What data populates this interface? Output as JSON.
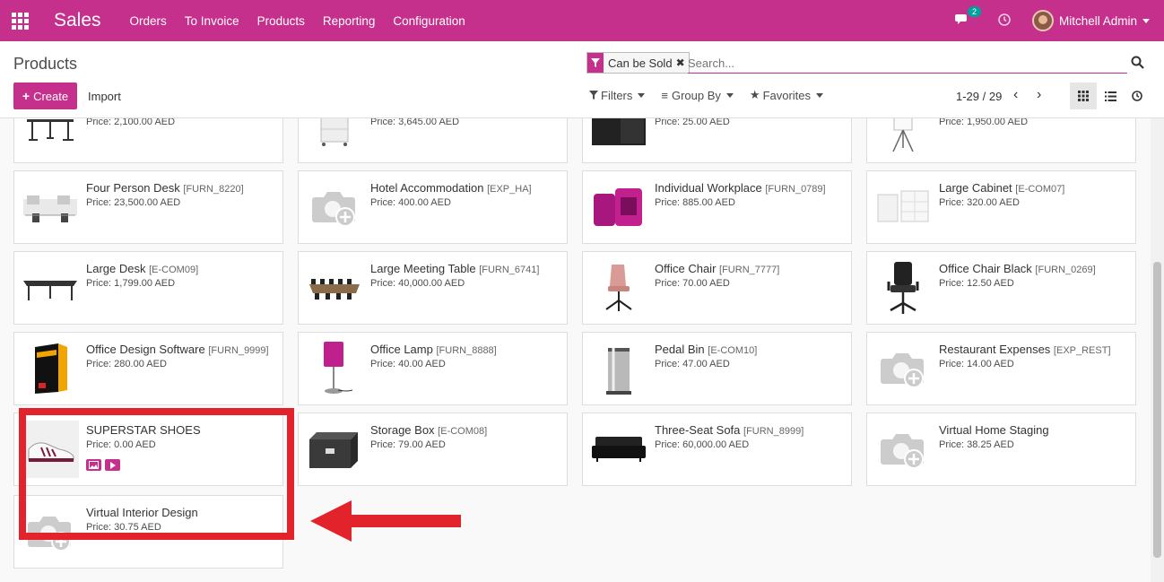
{
  "navbar": {
    "app_name": "Sales",
    "menu": [
      "Orders",
      "To Invoice",
      "Products",
      "Reporting",
      "Configuration"
    ],
    "chat_badge": "2",
    "user_name": "Mitchell Admin",
    "color": "#c5308c"
  },
  "control_panel": {
    "breadcrumb": "Products",
    "create_label": "Create",
    "import_label": "Import",
    "facet_label": "Can be Sold",
    "search_placeholder": "Search...",
    "filters_label": "Filters",
    "group_by_label": "Group By",
    "favorites_label": "Favorites",
    "pager": "1-29 / 29"
  },
  "products": [
    {
      "name": "",
      "code": "",
      "price": "Price: 2,100.00 AED",
      "image": "desk-image"
    },
    {
      "name": "",
      "code": "",
      "price": "Price: 3,645.00 AED",
      "image": "drawer-image"
    },
    {
      "name": "",
      "code": "",
      "price": "Price: 25.00 AED",
      "image": "cabinet-image"
    },
    {
      "name": "",
      "code": "",
      "price": "Price: 1,950.00 AED",
      "image": "flipchart-image"
    },
    {
      "name": "Four Person Desk",
      "code": "[FURN_8220]",
      "price": "Price: 23,500.00 AED",
      "image": "desks-image"
    },
    {
      "name": "Hotel Accommodation",
      "code": "[EXP_HA]",
      "price": "Price: 400.00 AED",
      "image": "placeholder-camera"
    },
    {
      "name": "Individual Workplace",
      "code": "[FURN_0789]",
      "price": "Price: 885.00 AED",
      "image": "booth-image"
    },
    {
      "name": "Large Cabinet",
      "code": "[E-COM07]",
      "price": "Price: 320.00 AED",
      "image": "cabinet-white-image"
    },
    {
      "name": "Large Desk",
      "code": "[E-COM09]",
      "price": "Price: 1,799.00 AED",
      "image": "desk-image"
    },
    {
      "name": "Large Meeting Table",
      "code": "[FURN_6741]",
      "price": "Price: 40,000.00 AED",
      "image": "meeting-table-image"
    },
    {
      "name": "Office Chair",
      "code": "[FURN_7777]",
      "price": "Price: 70.00 AED",
      "image": "chair-pink-image"
    },
    {
      "name": "Office Chair Black",
      "code": "[FURN_0269]",
      "price": "Price: 12.50 AED",
      "image": "chair-black-image"
    },
    {
      "name": "Office Design Software",
      "code": "[FURN_9999]",
      "price": "Price: 280.00 AED",
      "image": "software-box-image"
    },
    {
      "name": "Office Lamp",
      "code": "[FURN_8888]",
      "price": "Price: 40.00 AED",
      "image": "lamp-image"
    },
    {
      "name": "Pedal Bin",
      "code": "[E-COM10]",
      "price": "Price: 47.00 AED",
      "image": "bin-image"
    },
    {
      "name": "Restaurant Expenses",
      "code": "[EXP_REST]",
      "price": "Price: 14.00 AED",
      "image": "placeholder-camera"
    },
    {
      "name": "SUPERSTAR SHOES",
      "code": "",
      "price": "Price: 0.00 AED",
      "image": "shoe-image",
      "tags": [
        "image-icon",
        "video-icon"
      ]
    },
    {
      "name": "Storage Box",
      "code": "[E-COM08]",
      "price": "Price: 79.00 AED",
      "image": "storage-box-image"
    },
    {
      "name": "Three-Seat Sofa",
      "code": "[FURN_8999]",
      "price": "Price: 60,000.00 AED",
      "image": "sofa-image"
    },
    {
      "name": "Virtual Home Staging",
      "code": "",
      "price": "Price: 38.25 AED",
      "image": "placeholder-camera"
    },
    {
      "name": "Virtual Interior Design",
      "code": "",
      "price": "Price: 30.75 AED",
      "image": "placeholder-camera"
    }
  ],
  "annotation": {
    "box_color": "#e3232b"
  }
}
